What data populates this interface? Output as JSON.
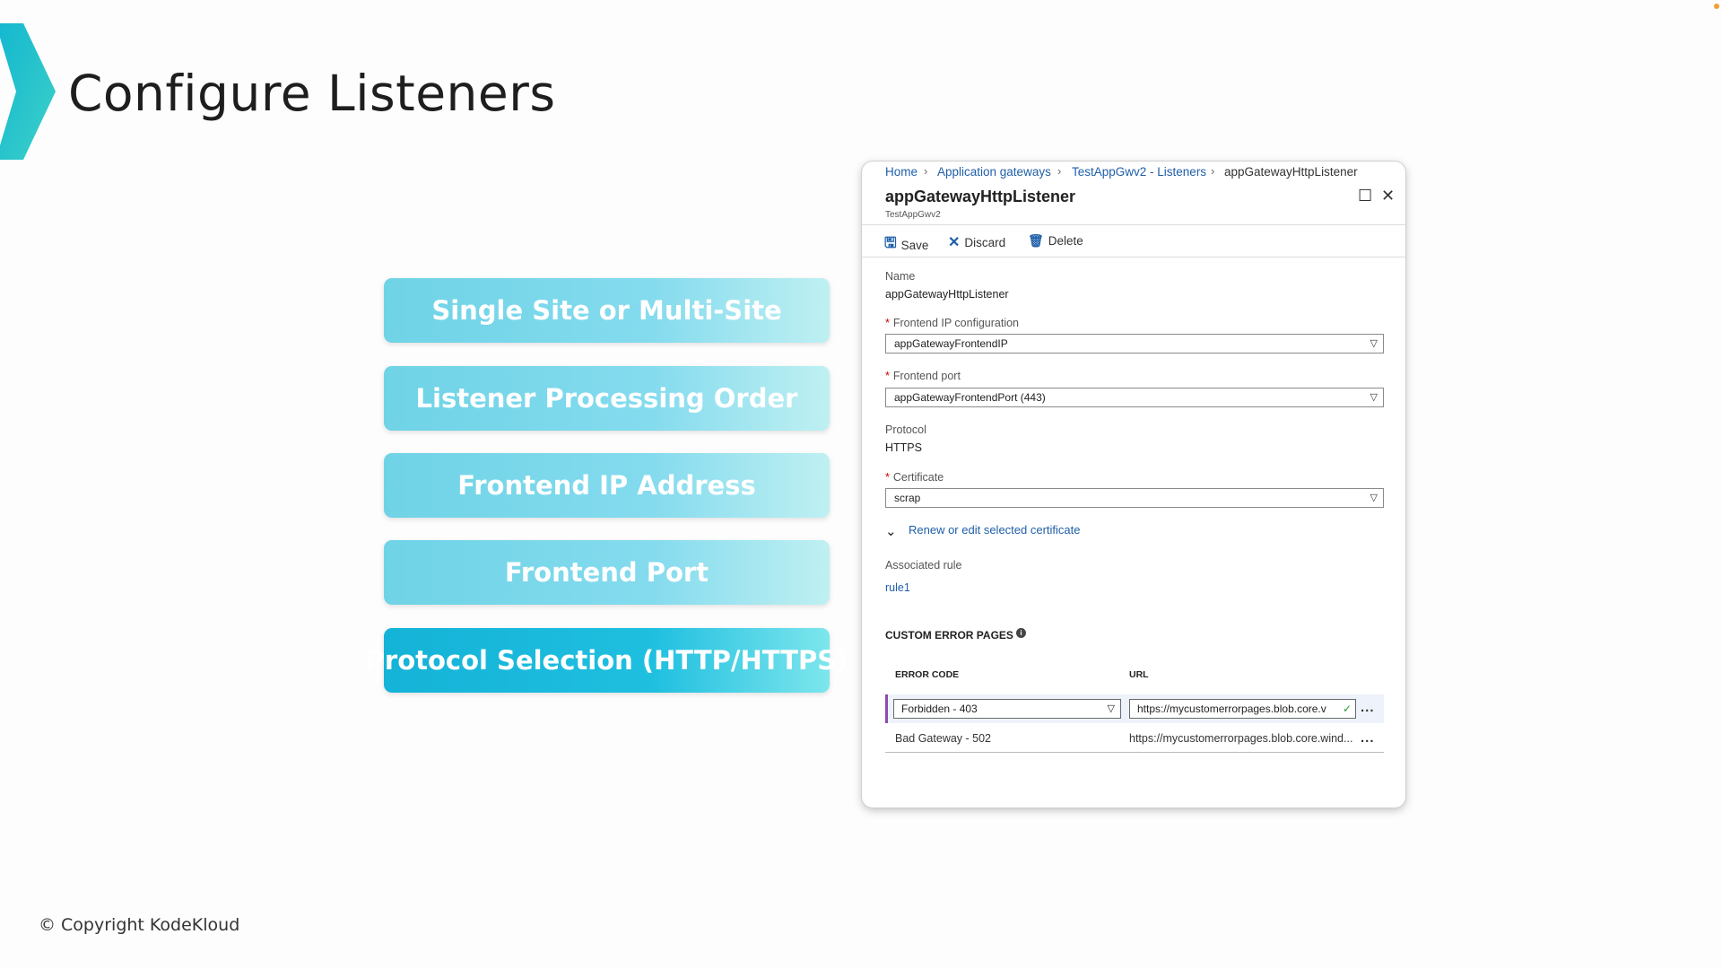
{
  "slide": {
    "title": "Configure Listeners",
    "topics": [
      "Single Site or Multi-Site",
      "Listener Processing Order",
      "Frontend IP Address",
      "Frontend Port",
      "Protocol Selection (HTTP/HTTPS)"
    ],
    "active_topic_index": 4,
    "copyright": "© Copyright KodeKloud"
  },
  "colors": {
    "topic_inactive": "#84dbee",
    "topic_active": "#14b3d7",
    "azure_link": "#1f5fa8",
    "required": "#c00000"
  },
  "panel": {
    "breadcrumb": [
      "Home",
      "Application gateways",
      "TestAppGwv2 - Listeners",
      "appGatewayHttpListener"
    ],
    "breadcrumb_separator": "›",
    "title": "appGatewayHttpListener",
    "subtitle": "TestAppGwv2",
    "header_icons": [
      "maximize-icon",
      "close-icon"
    ],
    "toolbar": {
      "save": "Save",
      "discard": "Discard",
      "delete": "Delete"
    },
    "form": {
      "name_label": "Name",
      "name_value": "appGatewayHttpListener",
      "frontend_ip_label": "Frontend IP configuration",
      "frontend_ip_value": "appGatewayFrontendIP",
      "frontend_port_label": "Frontend port",
      "frontend_port_value": "appGatewayFrontendPort (443)",
      "protocol_label": "Protocol",
      "protocol_value": "HTTPS",
      "certificate_label": "Certificate",
      "certificate_value": "scrap",
      "renew_link": "Renew or edit selected certificate",
      "associated_rule_label": "Associated rule",
      "associated_rule_value": "rule1"
    },
    "error_pages": {
      "section_title": "CUSTOM ERROR PAGES",
      "col_code": "ERROR CODE",
      "col_url": "URL",
      "rows": [
        {
          "code": "Forbidden - 403",
          "url": "https://mycustomerrorpages.blob.core.v"
        },
        {
          "code": "Bad Gateway - 502",
          "url": "https://mycustomerrorpages.blob.core.wind..."
        }
      ],
      "more": "..."
    }
  }
}
